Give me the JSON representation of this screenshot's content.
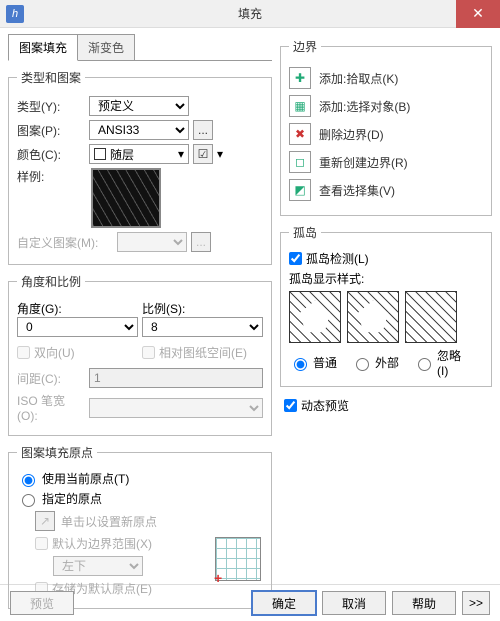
{
  "window": {
    "title": "填充",
    "appicon": "h"
  },
  "tabs": {
    "hatch": "图案填充",
    "gradient": "渐变色"
  },
  "type_pattern": {
    "legend": "类型和图案",
    "type_label": "类型(Y):",
    "type_value": "预定义",
    "pattern_label": "图案(P):",
    "pattern_value": "ANSI33",
    "color_label": "颜色(C):",
    "color_value": "随层",
    "sample_label": "样例:",
    "custom_label": "自定义图案(M):"
  },
  "angle_scale": {
    "legend": "角度和比例",
    "angle_label": "角度(G):",
    "angle_value": "0",
    "scale_label": "比例(S):",
    "scale_value": "8",
    "double_cb": "双向(U)",
    "paper_cb": "相对图纸空间(E)",
    "spacing_label": "间距(C):",
    "spacing_value": "1",
    "iso_label": "ISO 笔宽(O):"
  },
  "origin": {
    "legend": "图案填充原点",
    "use_current": "使用当前原点(T)",
    "specified": "指定的原点",
    "click_set": "单击以设置新原点",
    "default_bound": "默认为边界范围(X)",
    "corner_value": "左下",
    "store_default": "存储为默认原点(E)"
  },
  "boundary": {
    "legend": "边界",
    "add_pick": "添加:拾取点(K)",
    "add_select": "添加:选择对象(B)",
    "del_bound": "删除边界(D)",
    "recreate": "重新创建边界(R)",
    "view_sel": "查看选择集(V)"
  },
  "islands": {
    "legend": "孤岛",
    "detect_cb": "孤岛检测(L)",
    "style_label": "孤岛显示样式:",
    "opt_normal": "普通",
    "opt_outer": "外部",
    "opt_ignore": "忽略(I)"
  },
  "dynamic_preview": "动态预览",
  "buttons": {
    "preview": "预览",
    "ok": "确定",
    "cancel": "取消",
    "help": "帮助",
    "expand": ">>"
  },
  "misc": {
    "ellipsis": "...",
    "dropdown": "▾",
    "checkmark": "☑"
  }
}
